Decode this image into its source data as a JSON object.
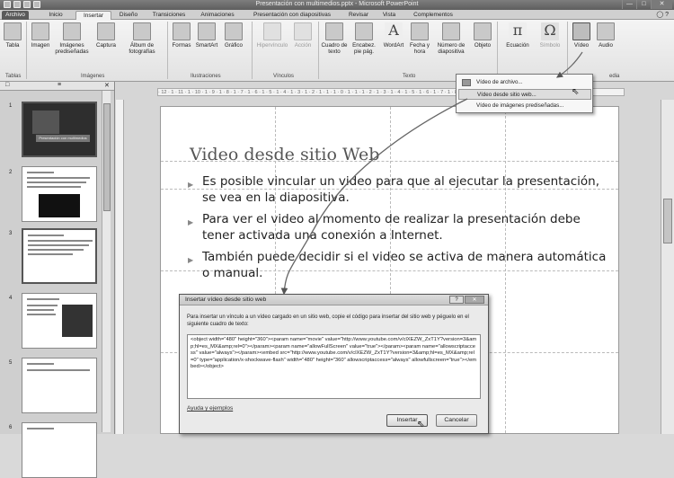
{
  "window": {
    "title": "Presentación con multimedios.pptx - Microsoft PowerPoint",
    "minimize": "—",
    "maximize": "□",
    "close": "✕"
  },
  "tabs": [
    {
      "label": "Archivo"
    },
    {
      "label": "Inicio"
    },
    {
      "label": "Insertar"
    },
    {
      "label": "Diseño"
    },
    {
      "label": "Transiciones"
    },
    {
      "label": "Animaciones"
    },
    {
      "label": "Presentación con diapositivas"
    },
    {
      "label": "Revisar"
    },
    {
      "label": "Vista"
    },
    {
      "label": "Complementos"
    }
  ],
  "ribbon": {
    "buttons": {
      "tabla": "Tabla",
      "imagen": "Imagen",
      "imagenes_pred": "Imágenes prediseñadas",
      "captura": "Captura",
      "album": "Álbum de fotografías",
      "formas": "Formas",
      "smartart": "SmartArt",
      "grafico": "Gráfico",
      "hipervinculo": "Hipervínculo",
      "accion": "Acción",
      "cuadro": "Cuadro de texto",
      "encabez": "Encabez. pie pág.",
      "wordart": "WordArt",
      "fecha": "Fecha y hora",
      "numero": "Número de diapositiva",
      "objeto": "Objeto",
      "ecuacion": "Ecuación",
      "simbolo": "Símbolo",
      "video": "Vídeo",
      "audio": "Audio"
    },
    "groups": {
      "tablas": "Tablas",
      "imagenes": "Imágenes",
      "ilustraciones": "Ilustraciones",
      "vinculos": "Vínculos",
      "texto": "Texto",
      "multimedia": "edia"
    },
    "glyphs": {
      "ecuacion": "π",
      "simbolo": "Ω",
      "wordart": "A"
    }
  },
  "video_menu": {
    "items": [
      {
        "label": "Vídeo de archivo..."
      },
      {
        "label": "Vídeo desde sitio web..."
      },
      {
        "label": "Vídeo de imágenes prediseñadas..."
      }
    ]
  },
  "panel": {
    "tab_slides": "□",
    "tab_outline": "≡",
    "close": "✕"
  },
  "thumbnails": [
    {
      "num": "1",
      "caption": "Presentación con multimedios"
    },
    {
      "num": "2",
      "caption": ""
    },
    {
      "num": "3",
      "caption": ""
    },
    {
      "num": "4",
      "caption": ""
    },
    {
      "num": "5",
      "caption": ""
    },
    {
      "num": "6",
      "caption": ""
    }
  ],
  "ruler": "· 12 · 1 · 11 · 1 · 10 · 1 · 9 · 1 · 8 · 1 · 7 · 1 · 6 · 1 · 5 · 1 · 4 · 1 · 3 · 1 · 2 · 1 · 1 · 1 · 0 · 1 · 1 · 1 · 2 · 1 · 3 · 1 · 4 · 1 · 5 · 1 · 6 · 1 · 7 · 1 · 8 · 1 · 9 · 1 · 10 · 1 · 11 · 1 · 12 ·",
  "slide": {
    "title": "Video desde sitio Web",
    "bullets": [
      "Es posible vincular un video para que al ejecutar la presentación, se vea en la diapositiva.",
      "Para ver el video al momento de realizar la presentación debe tener activada una conexión a Internet.",
      "También puede decidir si el video se activa de manera automática o manual."
    ]
  },
  "dialog": {
    "title": "Insertar vídeo desde sitio web",
    "help": "?",
    "close": "✕",
    "instructions": "Para insertar un vínculo a un vídeo cargado en un sitio web, copie el código para insertar del sitio web y péguelo en el siguiente cuadro de texto:",
    "code": "<object width=\"480\" height=\"360\"><param name=\"movie\" value=\"http://www.youtube.com/v/clXEZW_ZxT1Y?version=3&amp;hl=es_MX&amp;rel=0\"></param><param name=\"allowFullScreen\" value=\"true\"></param><param name=\"allowscriptaccess\" value=\"always\"></param><embed src=\"http://www.youtube.com/v/clXEZW_ZxT1Y?version=3&amp;hl=es_MX&amp;rel=0\" type=\"application/x-shockwave-flash\" width=\"480\" height=\"360\" allowscriptaccess=\"always\" allowfullscreen=\"true\"></embed></object>",
    "help_link": "Ayuda y ejemplos",
    "insert": "Insertar",
    "cancel": "Cancelar"
  }
}
